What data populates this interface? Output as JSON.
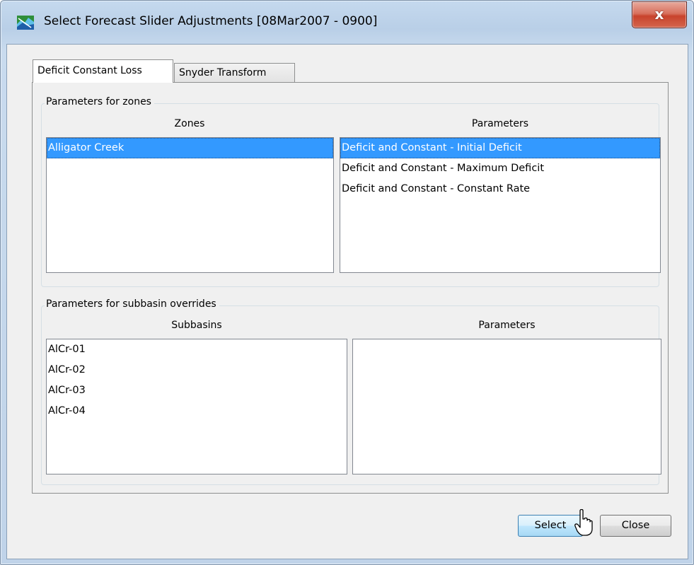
{
  "window": {
    "title": "Select Forecast Slider Adjustments [08Mar2007 - 0900]",
    "close_glyph": "x",
    "icon": "app-logo-icon"
  },
  "tabs": [
    {
      "label": "Deficit Constant Loss",
      "active": true
    },
    {
      "label": "Snyder Transform",
      "active": false
    }
  ],
  "zones_group": {
    "legend": "Parameters for zones",
    "zones_header": "Zones",
    "parameters_header": "Parameters",
    "zones": [
      "Alligator Creek"
    ],
    "selected_zone": "Alligator Creek",
    "parameters": [
      "Deficit and Constant - Initial Deficit",
      "Deficit and Constant - Maximum Deficit",
      "Deficit and Constant - Constant Rate"
    ],
    "selected_parameter": "Deficit and Constant - Initial Deficit"
  },
  "subbasin_group": {
    "legend": "Parameters for subbasin overrides",
    "subbasins_header": "Subbasins",
    "parameters_header": "Parameters",
    "subbasins": [
      "AlCr-01",
      "AlCr-02",
      "AlCr-03",
      "AlCr-04"
    ],
    "parameters": []
  },
  "buttons": {
    "select": "Select",
    "close": "Close"
  },
  "colors": {
    "selection": "#3399ff",
    "title_bar": "#c5d9ee",
    "close_button": "#c8432c"
  }
}
